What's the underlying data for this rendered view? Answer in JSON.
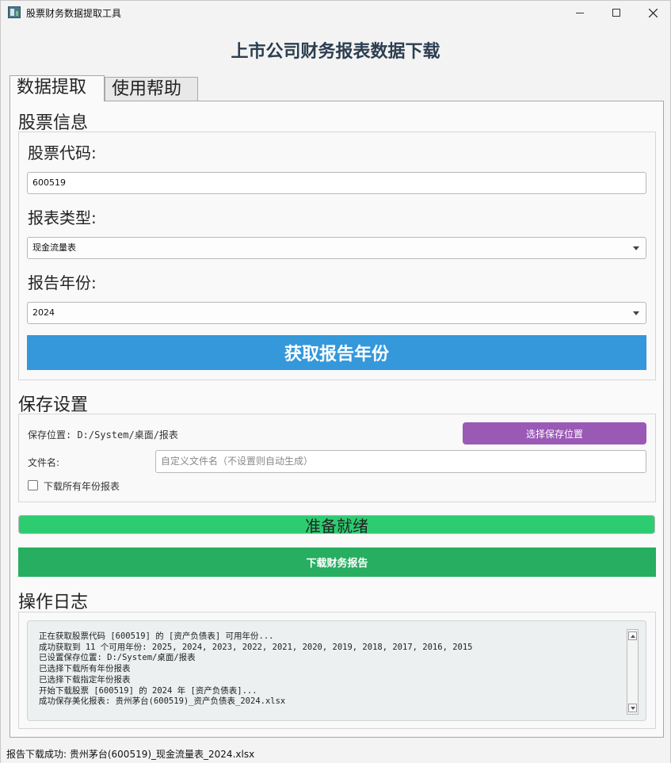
{
  "window": {
    "title": "股票财务数据提取工具"
  },
  "header": {
    "title": "上市公司财务报表数据下载"
  },
  "tabs": [
    {
      "label": "数据提取",
      "active": true
    },
    {
      "label": "使用帮助",
      "active": false
    }
  ],
  "stock_info": {
    "heading": "股票信息",
    "code_label": "股票代码:",
    "code_value": "600519",
    "report_type_label": "报表类型:",
    "report_type_value": "现金流量表",
    "year_label": "报告年份:",
    "year_value": "2024",
    "fetch_button": "获取报告年份"
  },
  "save_settings": {
    "heading": "保存设置",
    "save_location": "保存位置: D:/System/桌面/报表",
    "choose_button": "选择保存位置",
    "filename_label": "文件名:",
    "filename_placeholder": "自定义文件名（不设置则自动生成）",
    "download_all_label": "下载所有年份报表",
    "download_all_checked": false
  },
  "progress": {
    "text": "准备就绪",
    "percent": 100
  },
  "download_button": "下载财务报告",
  "log": {
    "heading": "操作日志",
    "lines": [
      "正在获取股票代码 [600519] 的 [资产负债表] 可用年份...",
      "成功获取到 11 个可用年份: 2025, 2024, 2023, 2022, 2021, 2020, 2019, 2018, 2017, 2016, 2015",
      "已设置保存位置: D:/System/桌面/报表",
      "已选择下载所有年份报表",
      "已选择下载指定年份报表",
      "开始下载股票 [600519] 的 2024 年 [资产负债表]...",
      "成功保存美化报表: 贵州茅台(600519)_资产负债表_2024.xlsx"
    ]
  },
  "status_bar": "报告下载成功: 贵州茅台(600519)_现金流量表_2024.xlsx",
  "colors": {
    "fetch_button": "#3498db",
    "choose_button": "#9b59b6",
    "progress": "#2ecc71",
    "download_button": "#27ae60",
    "title": "#2c3e50"
  }
}
